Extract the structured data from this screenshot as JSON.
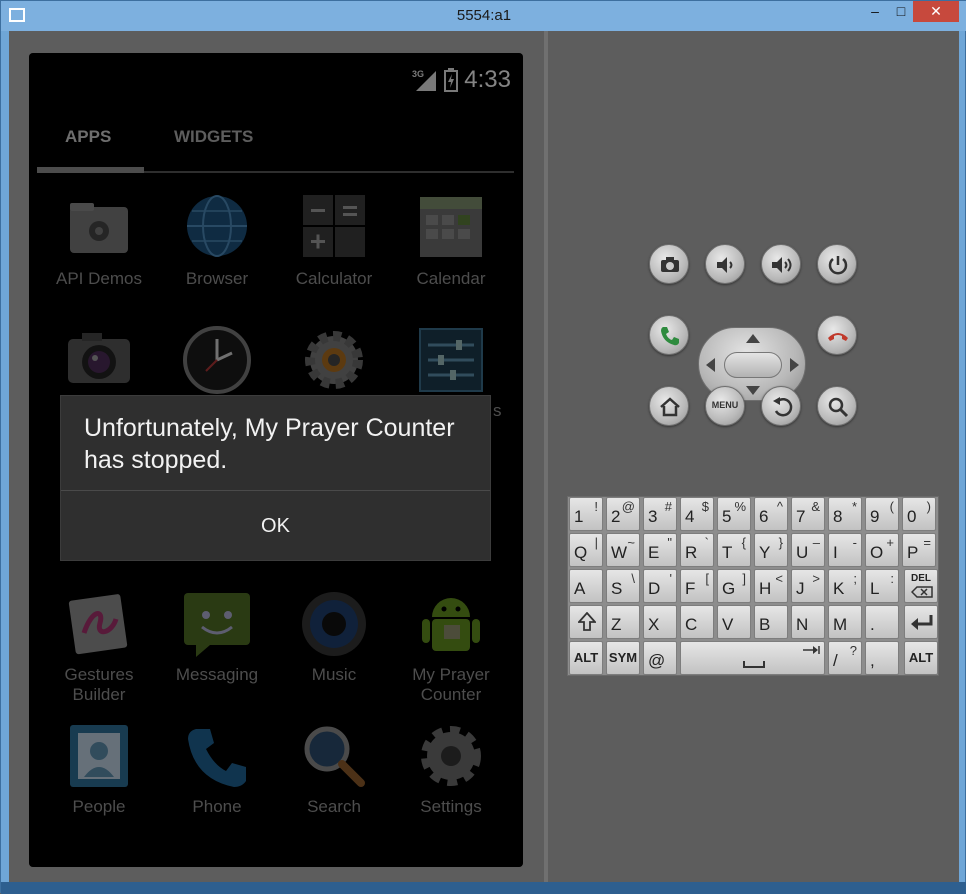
{
  "window": {
    "title": "5554:a1",
    "minimize": "‒",
    "maximize": "□",
    "close": "✕"
  },
  "status": {
    "network": "3G",
    "time": "4:33"
  },
  "tabs": [
    {
      "label": "APPS"
    },
    {
      "label": "WIDGETS"
    }
  ],
  "apps": [
    {
      "label": "API Demos",
      "icon": "folder-gear-icon"
    },
    {
      "label": "Browser",
      "icon": "globe-icon"
    },
    {
      "label": "Calculator",
      "icon": "calculator-icon"
    },
    {
      "label": "Calendar",
      "icon": "calendar-icon"
    },
    {
      "label": "",
      "icon": "camera-icon"
    },
    {
      "label": "",
      "icon": "clock-icon"
    },
    {
      "label": "",
      "icon": "settings-gear-orange-icon"
    },
    {
      "label": "s",
      "icon": "sliders-icon"
    },
    {
      "label": "Gestures Builder",
      "icon": "gestures-icon"
    },
    {
      "label": "Messaging",
      "icon": "message-icon"
    },
    {
      "label": "Music",
      "icon": "speaker-icon"
    },
    {
      "label": "My Prayer Counter",
      "icon": "android-icon"
    },
    {
      "label": "People",
      "icon": "contacts-icon"
    },
    {
      "label": "Phone",
      "icon": "phone-icon"
    },
    {
      "label": "Search",
      "icon": "magnifier-icon"
    },
    {
      "label": "Settings",
      "icon": "gear-icon"
    }
  ],
  "dialog": {
    "message": "Unfortunately, My Prayer Counter has stopped.",
    "ok": "OK"
  },
  "controls": {
    "menu": "MENU"
  },
  "keyboard": {
    "row1": [
      [
        "1",
        "!"
      ],
      [
        "2",
        "@"
      ],
      [
        "3",
        "#"
      ],
      [
        "4",
        "$"
      ],
      [
        "5",
        "%"
      ],
      [
        "6",
        "^"
      ],
      [
        "7",
        "&"
      ],
      [
        "8",
        "*"
      ],
      [
        "9",
        "("
      ],
      [
        "0",
        ")"
      ]
    ],
    "row2": [
      [
        "Q",
        "|"
      ],
      [
        "W",
        "~"
      ],
      [
        "E",
        "\""
      ],
      [
        "R",
        "`"
      ],
      [
        "T",
        "{"
      ],
      [
        "Y",
        "}"
      ],
      [
        "U",
        "–"
      ],
      [
        "I",
        "-"
      ],
      [
        "O",
        "+"
      ],
      [
        "P",
        "="
      ]
    ],
    "row3": [
      [
        "A",
        ""
      ],
      [
        "S",
        "\\"
      ],
      [
        "D",
        "'"
      ],
      [
        "F",
        "["
      ],
      [
        "G",
        "]"
      ],
      [
        "H",
        "<"
      ],
      [
        "J",
        ">"
      ],
      [
        "K",
        ";"
      ],
      [
        "L",
        ":"
      ]
    ],
    "row4": [
      [
        "Z",
        ""
      ],
      [
        "X",
        ""
      ],
      [
        "C",
        ""
      ],
      [
        "V",
        ""
      ],
      [
        "B",
        ""
      ],
      [
        "N",
        ""
      ],
      [
        "M",
        ""
      ],
      [
        ".",
        ""
      ]
    ],
    "del": "DEL",
    "alt": "ALT",
    "sym": "SYM",
    "at": "@",
    "slash": [
      "/",
      "?"
    ],
    "comma": ","
  },
  "colors": {
    "screen_bg": "#000000",
    "dialog_bg": "#2f2f2f",
    "end_call": "#c0392b",
    "call": "#2e8b3e"
  }
}
